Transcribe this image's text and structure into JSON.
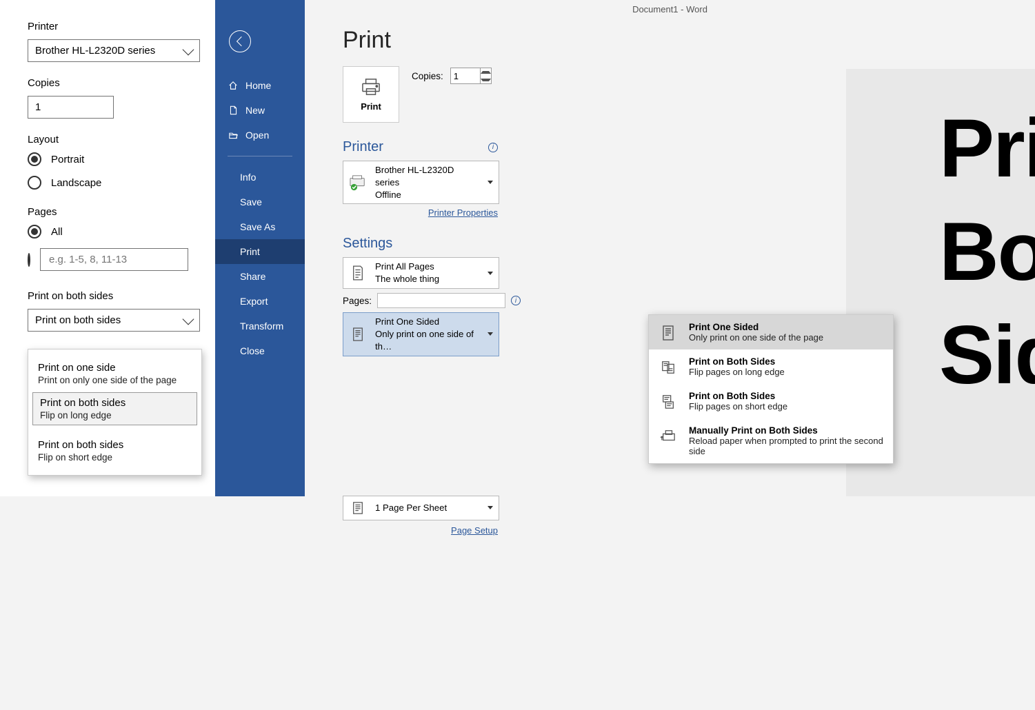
{
  "title_bar": "Document1  -  Word",
  "left": {
    "printer_label": "Printer",
    "printer_value": "Brother HL-L2320D series",
    "copies_label": "Copies",
    "copies_value": "1",
    "layout_label": "Layout",
    "portrait": "Portrait",
    "landscape": "Landscape",
    "pages_label": "Pages",
    "all": "All",
    "pages_placeholder": "e.g. 1-5, 8, 11-13",
    "duplex_label": "Print on both sides",
    "duplex_value": "Print on both sides",
    "dd": {
      "one_t": "Print on one side",
      "one_s": "Print on only one side of the page",
      "long_t": "Print on both sides",
      "long_s": "Flip on long edge",
      "short_t": "Print on both sides",
      "short_s": "Flip on short edge"
    }
  },
  "nav": {
    "home": "Home",
    "new": "New",
    "open": "Open",
    "info": "Info",
    "save": "Save",
    "saveas": "Save As",
    "print": "Print",
    "share": "Share",
    "export": "Export",
    "transform": "Transform",
    "close": "Close"
  },
  "main": {
    "heading": "Print",
    "print_btn": "Print",
    "copies_label": "Copies:",
    "copies_value": "1",
    "printer_h": "Printer",
    "printer_name": "Brother HL-L2320D series",
    "printer_status": "Offline",
    "printer_props": "Printer Properties",
    "settings_h": "Settings",
    "print_all_t": "Print All Pages",
    "print_all_s": "The whole thing",
    "pages_lbl": "Pages:",
    "duplex_t": "Print One Sided",
    "duplex_s": "Only print on one side of th…",
    "perpage": "1 Page Per Sheet",
    "page_setup": "Page Setup",
    "menu": {
      "one_t": "Print One Sided",
      "one_s": "Only print on one side of the page",
      "long_t": "Print on Both Sides",
      "long_s": "Flip pages on long edge",
      "short_t": "Print on Both Sides",
      "short_s": "Flip pages on short edge",
      "manual_t": "Manually Print on Both Sides",
      "manual_s": "Reload paper when prompted to print the second side"
    }
  },
  "preview_text": "Print\nBoth\nSides"
}
